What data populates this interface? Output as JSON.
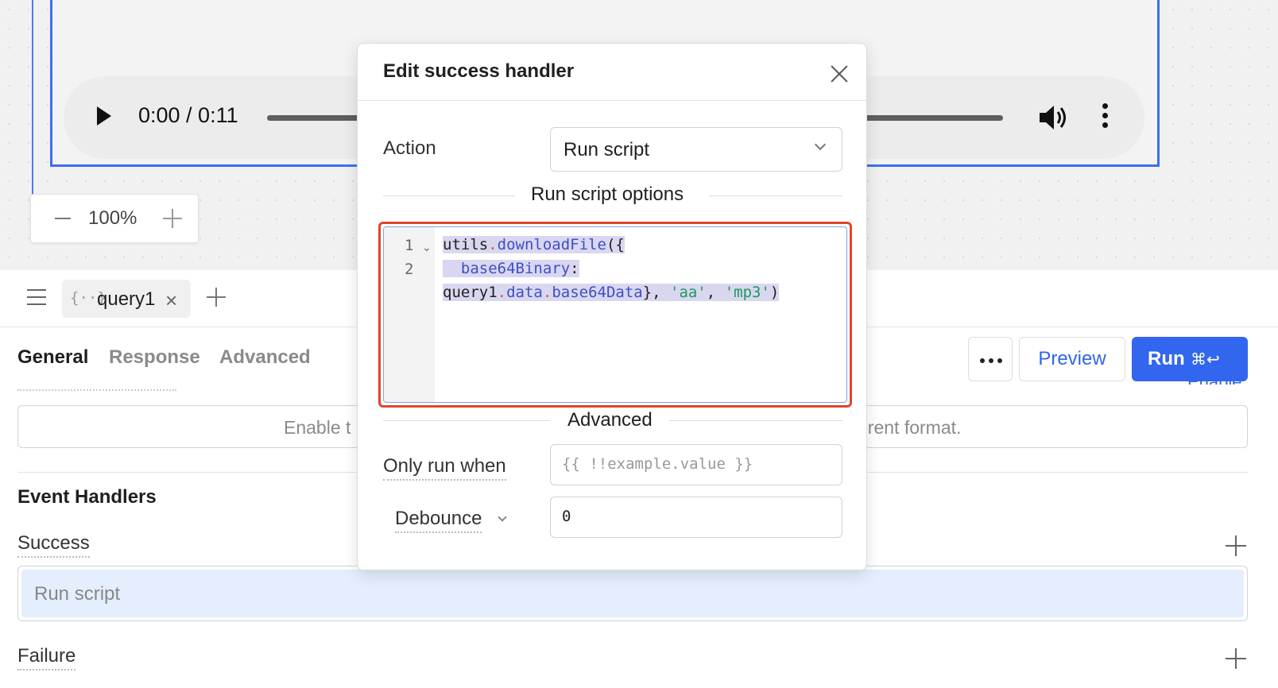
{
  "canvas": {
    "audio": {
      "time": "0:00 / 0:11"
    },
    "zoom": {
      "value": "100%"
    }
  },
  "bottom_panel": {
    "tab": {
      "label": "query1",
      "icon": "{··}"
    },
    "subtabs": [
      "General",
      "Response",
      "Advanced"
    ],
    "actions": {
      "preview_label": "Preview",
      "run_label": "Run",
      "run_shortcut": "⌘↩"
    },
    "enable_link": "Enable",
    "format_bar": {
      "left_text": "Enable t",
      "right_text": "erent format."
    },
    "event_handlers": {
      "title": "Event Handlers",
      "success_label": "Success",
      "success_row": "Run script",
      "failure_label": "Failure"
    }
  },
  "modal": {
    "title": "Edit success handler",
    "action_label": "Action",
    "action_value": "Run script",
    "options_header": "Run script options",
    "code": {
      "line_numbers": [
        "1",
        "2"
      ],
      "line1": [
        "utils",
        ".",
        "downloadFile",
        "({"
      ],
      "line2": [
        "  ",
        "base64Binary",
        ":"
      ],
      "line3": [
        "query1",
        ".",
        "data",
        ".",
        "base64Data",
        "}, ",
        "'aa'",
        ", ",
        "'mp3'",
        ")"
      ]
    },
    "advanced_header": "Advanced",
    "only_run_when_label": "Only run when",
    "only_run_when_placeholder": "{{ !!example.value }}",
    "debounce_label": "Debounce",
    "debounce_value": "0"
  },
  "colors": {
    "accent": "#3366ee",
    "highlight_border": "#e0452a",
    "selection": "#d9d7f0"
  },
  "icons": [
    "play-icon",
    "volume-icon",
    "more-vertical-icon",
    "minus-icon",
    "plus-icon",
    "menu-icon",
    "code-braces-icon",
    "close-icon",
    "chevron-down-icon",
    "more-horizontal-icon"
  ]
}
